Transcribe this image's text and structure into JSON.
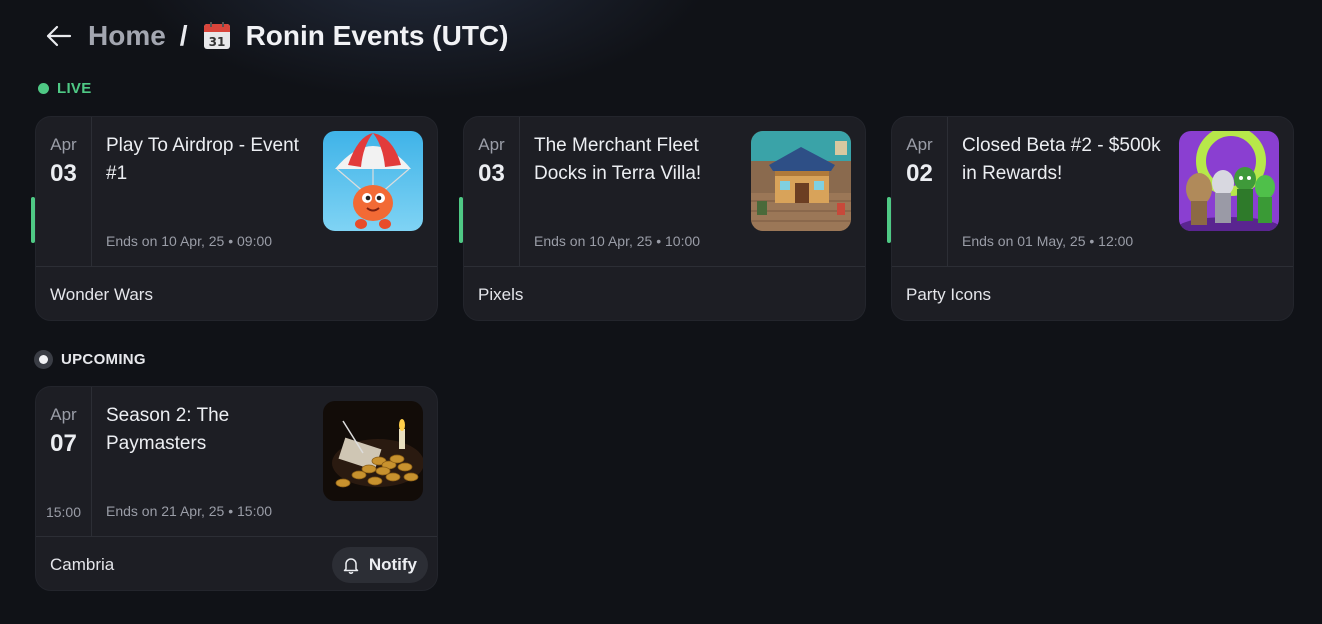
{
  "breadcrumb": {
    "home": "Home",
    "separator": "/",
    "current": "Ronin Events (UTC)"
  },
  "sections": {
    "live": "LIVE",
    "upcoming": "UPCOMING"
  },
  "colors": {
    "live_accent": "#4fc985",
    "card_bg": "#1d1e24",
    "page_bg": "#101217"
  },
  "live_events": [
    {
      "month": "Apr",
      "day": "03",
      "title": "Play To Airdrop - Event #1",
      "ends": "Ends on 10 Apr, 25 • 09:00",
      "game": "Wonder Wars",
      "thumb": "parachute-character-image"
    },
    {
      "month": "Apr",
      "day": "03",
      "title": "The Merchant Fleet Docks in Terra Villa!",
      "ends": "Ends on 10 Apr, 25 • 10:00",
      "game": "Pixels",
      "thumb": "pixel-house-image"
    },
    {
      "month": "Apr",
      "day": "02",
      "title": "Closed Beta #2 - $500k in Rewards!",
      "ends": "Ends on 01 May, 25 • 12:00",
      "game": "Party Icons",
      "thumb": "party-characters-image"
    }
  ],
  "upcoming_events": [
    {
      "month": "Apr",
      "day": "07",
      "time": "15:00",
      "title": "Season 2: The Paymasters",
      "ends": "Ends on 21 Apr, 25 • 15:00",
      "game": "Cambria",
      "thumb": "gold-coins-image",
      "action": "Notify"
    }
  ]
}
